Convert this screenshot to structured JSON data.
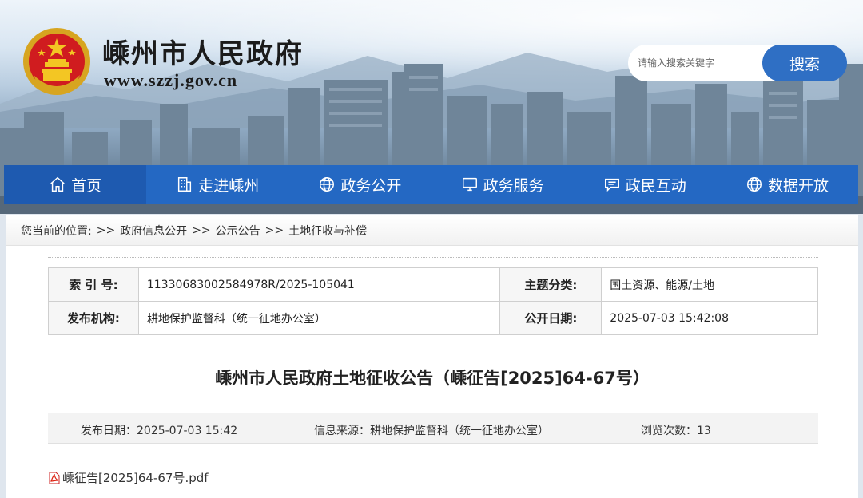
{
  "header": {
    "site_title": "嵊州市人民政府",
    "site_url": "www.szzj.gov.cn",
    "search_placeholder": "请输入搜索关键字",
    "search_button": "搜索"
  },
  "nav": {
    "items": [
      {
        "label": "首页",
        "icon": "home-icon",
        "active": true
      },
      {
        "label": "走进嵊州",
        "icon": "building-icon"
      },
      {
        "label": "政务公开",
        "icon": "globe-icon"
      },
      {
        "label": "政务服务",
        "icon": "monitor-icon"
      },
      {
        "label": "政民互动",
        "icon": "chat-icon"
      },
      {
        "label": "数据开放",
        "icon": "globe-icon"
      }
    ]
  },
  "breadcrumb": {
    "prefix": "您当前的位置:",
    "items": [
      "政府信息公开",
      "公示公告",
      "土地征收与补偿"
    ],
    "separator": ">>"
  },
  "meta": {
    "index_label": "索 引 号:",
    "index_value": "11330683002584978R/2025-105041",
    "topic_label": "主题分类:",
    "topic_value": "国土资源、能源/土地",
    "publisher_label": "发布机构:",
    "publisher_value": "耕地保护监督科（统一征地办公室）",
    "public_date_label": "公开日期:",
    "public_date_value": "2025-07-03 15:42:08"
  },
  "article": {
    "title": "嵊州市人民政府土地征收公告（嵊征告[2025]64-67号）",
    "publish_date_label": "发布日期：",
    "publish_date": "2025-07-03 15:42",
    "source_label": "信息来源：",
    "source": "耕地保护监督科（统一征地办公室）",
    "views_label": "浏览次数：",
    "views": "13",
    "attachment": "嵊征告[2025]64-67号.pdf"
  },
  "colors": {
    "nav_bg": "#2468c3",
    "search_button": "#2f6fc4"
  }
}
